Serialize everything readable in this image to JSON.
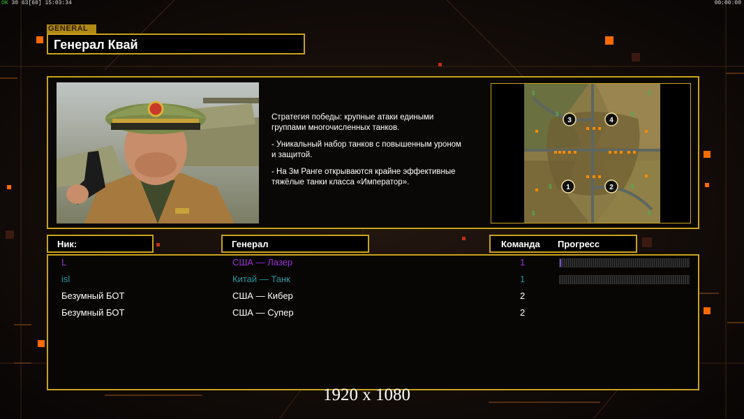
{
  "topbar": {
    "left_ok": "OK",
    "left_stats": "30 63",
    "left_fps": "[60]",
    "left_time": "15:03:34",
    "right_time": "00:00:00"
  },
  "section_tag": "GENERAL",
  "general_title": "Генерал Квай",
  "description": [
    "Стратегия победы: крупные атаки едиными\n группами многочисленных танков.",
    "- Уникальный набор танков с повышенным уроном\n и защитой.",
    "- На 3м Ранге открываются крайне эффективные\n тяжёлые танки класса «Император»."
  ],
  "map": {
    "spawn_labels": [
      "3",
      "4",
      "1",
      "2"
    ]
  },
  "headers": {
    "nick": "Ник:",
    "general": "Генерал",
    "team": "Команда",
    "progress": "Прогресс"
  },
  "players": [
    {
      "nick": "L",
      "general": "США — Лазер",
      "team": "1",
      "color": "#9b2fd6",
      "progress": 0.01,
      "show_progress": true
    },
    {
      "nick": "isl",
      "general": "Китай — Танк",
      "team": "1",
      "color": "#1e9aa0",
      "progress": 0.0,
      "show_progress": true
    },
    {
      "nick": "Безумный БОТ",
      "general": "США — Кибер",
      "team": "2",
      "color": "#ffffff",
      "show_progress": false
    },
    {
      "nick": "Безумный БОТ",
      "general": "США — Супер",
      "team": "2",
      "color": "#ffffff",
      "show_progress": false
    }
  ],
  "resolution_label": "1920 x 1080",
  "colors": {
    "accent_gold": "#c9a21b",
    "glow_orange": "#ff6a00"
  }
}
